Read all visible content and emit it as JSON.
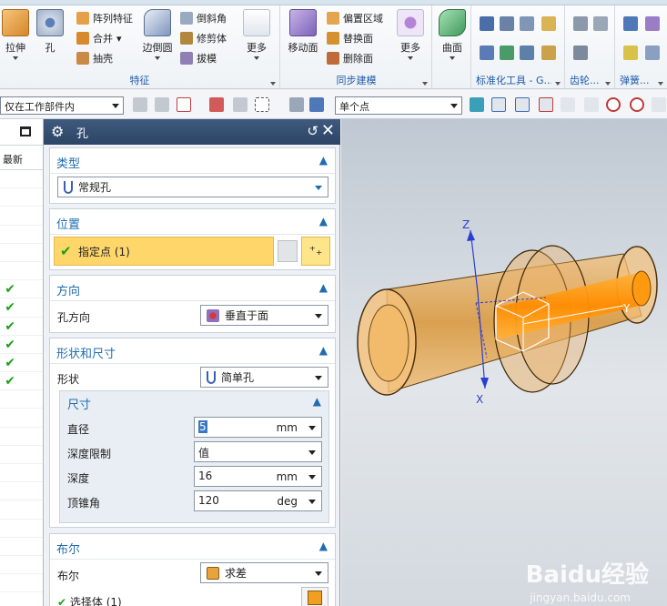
{
  "ribbon": {
    "feature_group": {
      "label": "特征",
      "big_buttons": [
        "拉伸",
        "孔",
        "边倒圆"
      ],
      "small_buttons": [
        "阵列特征",
        "合并",
        "抽壳",
        "倒斜角",
        "修剪体",
        "拔模"
      ],
      "more": "更多"
    },
    "sync_group": {
      "label": "同步建模",
      "big_buttons": [
        "移动面"
      ],
      "small_buttons": [
        "偏置区域",
        "替换面",
        "删除面"
      ],
      "more": "更多"
    },
    "surface": {
      "label": "曲面"
    },
    "small_groups": [
      "标准化工具 - G...",
      "齿轮...",
      "弹簧..."
    ]
  },
  "toolbar": {
    "filter_combo": "仅在工作部件内",
    "snap_combo": "单个点"
  },
  "navigator": {
    "column_header": "最新",
    "checked_rows": [
      6,
      7,
      8,
      9,
      10,
      11
    ]
  },
  "dialog": {
    "title": "孔",
    "type": {
      "header": "类型",
      "value": "常规孔"
    },
    "position": {
      "header": "位置",
      "specify_point": "指定点 (1)"
    },
    "direction": {
      "header": "方向",
      "label": "孔方向",
      "value": "垂直于面"
    },
    "shape": {
      "header": "形状和尺寸",
      "shape_label": "形状",
      "shape_value": "简单孔",
      "dimensions": {
        "header": "尺寸",
        "diameter": {
          "label": "直径",
          "value": "5",
          "unit": "mm"
        },
        "depth_limit": {
          "label": "深度限制",
          "value": "值"
        },
        "depth": {
          "label": "深度",
          "value": "16",
          "unit": "mm"
        },
        "tip_angle": {
          "label": "顶锥角",
          "value": "120",
          "unit": "deg"
        }
      }
    },
    "boolean": {
      "header": "布尔",
      "label": "布尔",
      "value": "求差",
      "select_body": "选择体 (1)"
    }
  },
  "viewport": {
    "axes": [
      "Z",
      "Y",
      "X"
    ],
    "watermark": "Baidu经验",
    "watermark_url": "jingyan.baidu.com"
  },
  "colors": {
    "accent": "#1f6db0",
    "title_bar": "#2c4566",
    "highlight": "#ffd66a",
    "part": "#e8a13a"
  }
}
